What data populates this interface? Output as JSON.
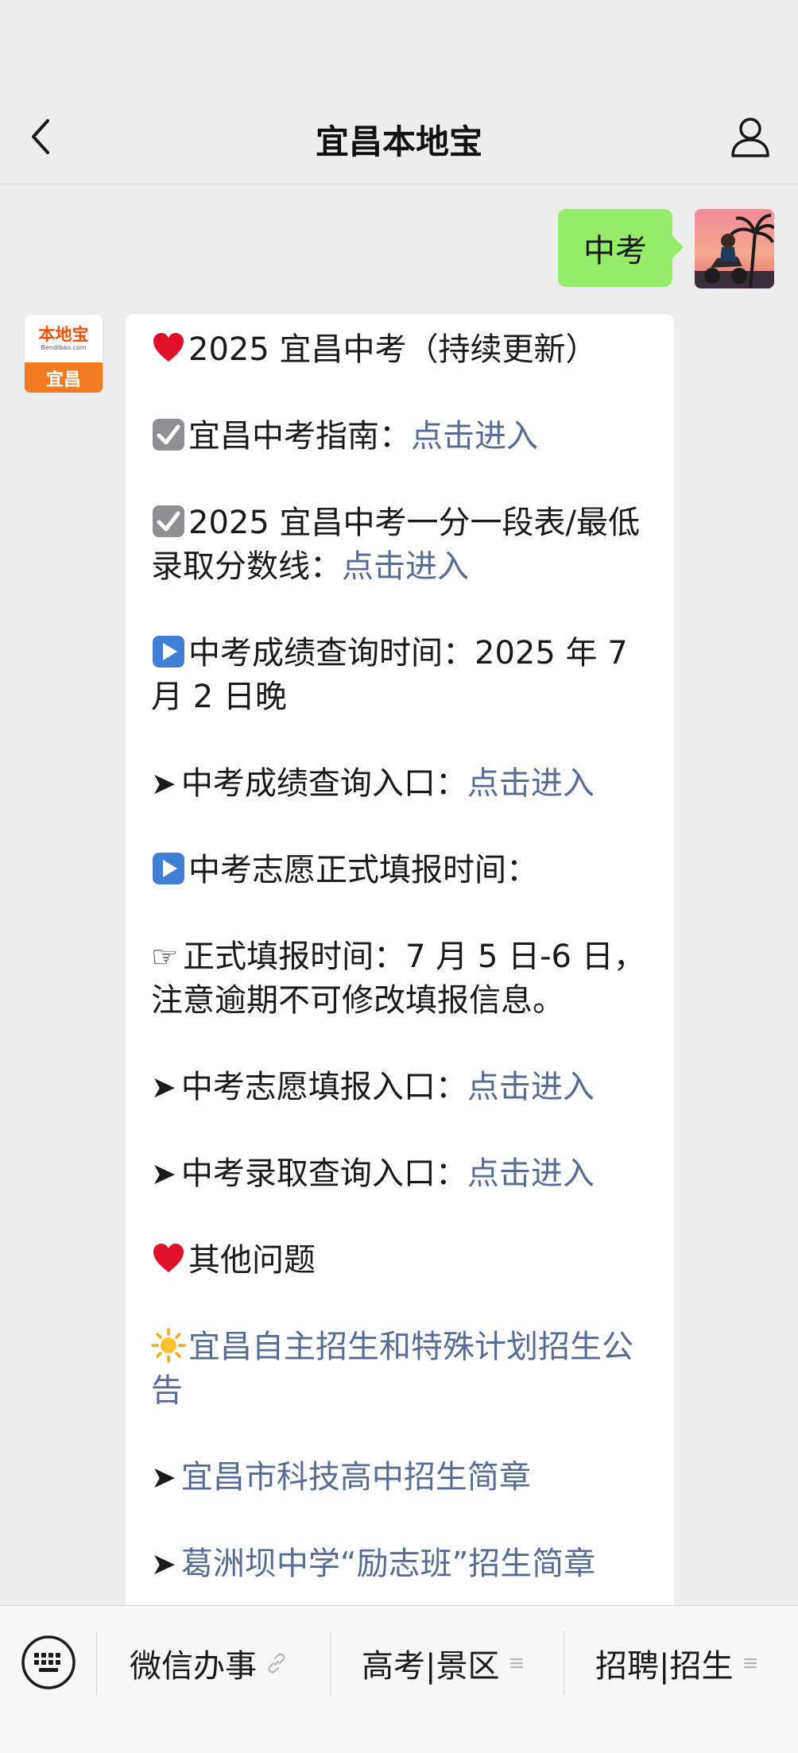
{
  "header": {
    "title": "宜昌本地宝"
  },
  "user_message": {
    "text": "中考"
  },
  "bot_avatar": {
    "brand": "本地宝",
    "domain": "Bendibao.com",
    "city": "宜昌"
  },
  "reply": {
    "l1_text": "2025 宜昌中考（持续更新）",
    "l2_text": "宜昌中考指南：",
    "l2_link": "点击进入",
    "l3_text": "2025 宜昌中考一分一段表/最低录取分数线：",
    "l3_link": "点击进入",
    "l4_text": "中考成绩查询时间：2025 年 7 月 2 日晚",
    "l5_arrow": "➤",
    "l5_text": "中考成绩查询入口：",
    "l5_link": "点击进入",
    "l6_text": "中考志愿正式填报时间：",
    "l7_hand": "☞",
    "l7_text": "正式填报时间：7 月 5 日-6 日，注意逾期不可修改填报信息。",
    "l8_arrow": "➤",
    "l8_text": "中考志愿填报入口：",
    "l8_link": "点击进入",
    "l9_arrow": "➤",
    "l9_text": "中考录取查询入口：",
    "l9_link": "点击进入",
    "l10_text": "其他问题",
    "l11_link": "宜昌自主招生和特殊计划招生公告",
    "l12_arrow": "➤",
    "l12_link": "宜昌市科技高中招生简章",
    "l13_arrow": "➤",
    "l13_link": "葛洲坝中学“励志班”招生简章"
  },
  "bottom_menu": {
    "item1": "微信办事",
    "item2": "高考|景区",
    "item3": "招聘|招生"
  },
  "colors": {
    "link": "#576b95",
    "outgoing_bubble": "#95ec69",
    "chat_bg": "#ededed"
  }
}
